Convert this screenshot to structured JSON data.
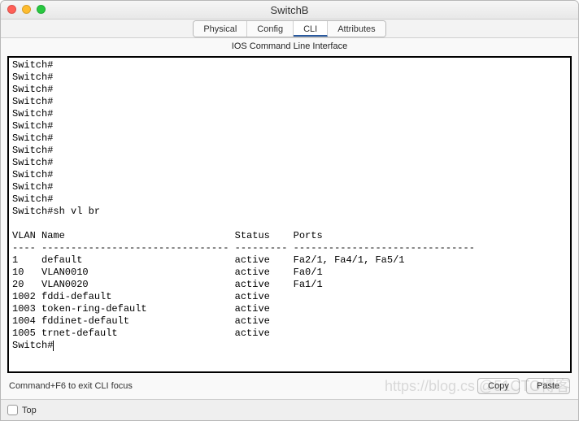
{
  "window": {
    "title": "SwitchB"
  },
  "tabs": {
    "physical": "Physical",
    "config": "Config",
    "cli": "CLI",
    "attributes": "Attributes"
  },
  "sublabel": "IOS Command Line Interface",
  "terminal": {
    "prompt_lines": [
      "Switch#",
      "Switch#",
      "Switch#",
      "Switch#",
      "Switch#",
      "Switch#",
      "Switch#",
      "Switch#",
      "Switch#",
      "Switch#",
      "Switch#",
      "Switch#"
    ],
    "command_line": "Switch#sh vl br",
    "blank": "",
    "header": "VLAN Name                             Status    Ports",
    "divider": "---- -------------------------------- --------- -------------------------------",
    "rows": [
      "1    default                          active    Fa2/1, Fa4/1, Fa5/1",
      "10   VLAN0010                         active    Fa0/1",
      "20   VLAN0020                         active    Fa1/1",
      "1002 fddi-default                     active    ",
      "1003 token-ring-default               active    ",
      "1004 fddinet-default                  active    ",
      "1005 trnet-default                    active    "
    ],
    "final_prompt": "Switch#"
  },
  "hint": "Command+F6 to exit CLI focus",
  "buttons": {
    "copy": "Copy",
    "paste": "Paste"
  },
  "footer": {
    "top": "Top"
  },
  "watermark": "https://blog.cs  @51CTO博客"
}
